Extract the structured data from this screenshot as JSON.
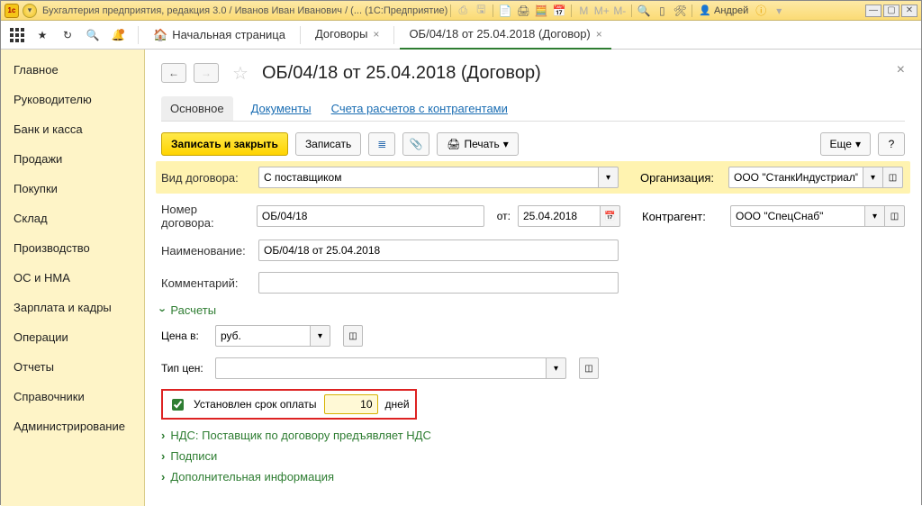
{
  "titlebar": {
    "text": "Бухгалтерия предприятия, редакция 3.0 / Иванов Иван Иванович / (...  (1С:Предприятие)",
    "user": "Андрей"
  },
  "toolbar": {
    "home": "Начальная страница",
    "tabs": [
      {
        "label": "Договоры",
        "active": false
      },
      {
        "label": "ОБ/04/18 от 25.04.2018 (Договор)",
        "active": true
      }
    ]
  },
  "sidebar": {
    "items": [
      "Главное",
      "Руководителю",
      "Банк и касса",
      "Продажи",
      "Покупки",
      "Склад",
      "Производство",
      "ОС и НМА",
      "Зарплата и кадры",
      "Операции",
      "Отчеты",
      "Справочники",
      "Администрирование"
    ]
  },
  "page": {
    "title": "ОБ/04/18 от 25.04.2018 (Договор)",
    "section_tabs": {
      "main": "Основное",
      "docs": "Документы",
      "settlements": "Счета расчетов с контрагентами"
    },
    "actions": {
      "save_close": "Записать и закрыть",
      "save": "Записать",
      "print": "Печать",
      "more": "Еще"
    },
    "fields": {
      "contract_type_label": "Вид договора:",
      "contract_type_value": "С поставщиком",
      "org_label": "Организация:",
      "org_value": "ООО \"СтанкИндустриал\"",
      "number_label": "Номер договора:",
      "number_value": "ОБ/04/18",
      "from_label": "от:",
      "date_value": "25.04.2018",
      "counterparty_label": "Контрагент:",
      "counterparty_value": "ООО \"СпецСнаб\"",
      "name_label": "Наименование:",
      "name_value": "ОБ/04/18 от 25.04.2018",
      "comment_label": "Комментарий:",
      "comment_value": ""
    },
    "calc": {
      "header": "Расчеты",
      "price_in_label": "Цена в:",
      "price_in_value": "руб.",
      "price_type_label": "Тип цен:",
      "price_type_value": "",
      "deadline_label": "Установлен срок оплаты",
      "deadline_value": "10",
      "deadline_unit": "дней"
    },
    "expanders": {
      "vat": "НДС: Поставщик по договору предъявляет НДС",
      "sign": "Подписи",
      "extra": "Дополнительная информация"
    }
  }
}
